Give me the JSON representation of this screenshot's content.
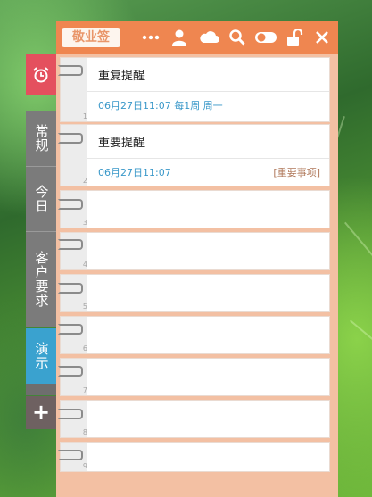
{
  "app": {
    "logo_label": "敬业签"
  },
  "toolbar": {
    "icons": [
      "more-icon",
      "user-icon",
      "cloud-icon",
      "search-icon",
      "toggle-icon",
      "unlock-icon",
      "close-icon"
    ]
  },
  "side_tabs": [
    {
      "icon": "alarm-clock-icon"
    },
    {
      "label": "常规"
    },
    {
      "label": "今日"
    },
    {
      "label": "客户要求"
    },
    {
      "label": "演示"
    },
    {
      "label": "+"
    }
  ],
  "notes": [
    {
      "index": "1",
      "title": "重复提醒",
      "date": "06月27日11:07 每1周 周一",
      "tag": ""
    },
    {
      "index": "2",
      "title": "重要提醒",
      "date": "06月27日11:07",
      "tag": "[重要事项]"
    },
    {
      "index": "3"
    },
    {
      "index": "4"
    },
    {
      "index": "5"
    },
    {
      "index": "6"
    },
    {
      "index": "7"
    },
    {
      "index": "8"
    },
    {
      "index": "9"
    }
  ],
  "colors": {
    "titlebar": "#ef8650",
    "panel": "#f3c0a3",
    "alarm_tab": "#e4505e",
    "active_tab": "#3aa2cf",
    "date_text": "#3a98c9"
  }
}
